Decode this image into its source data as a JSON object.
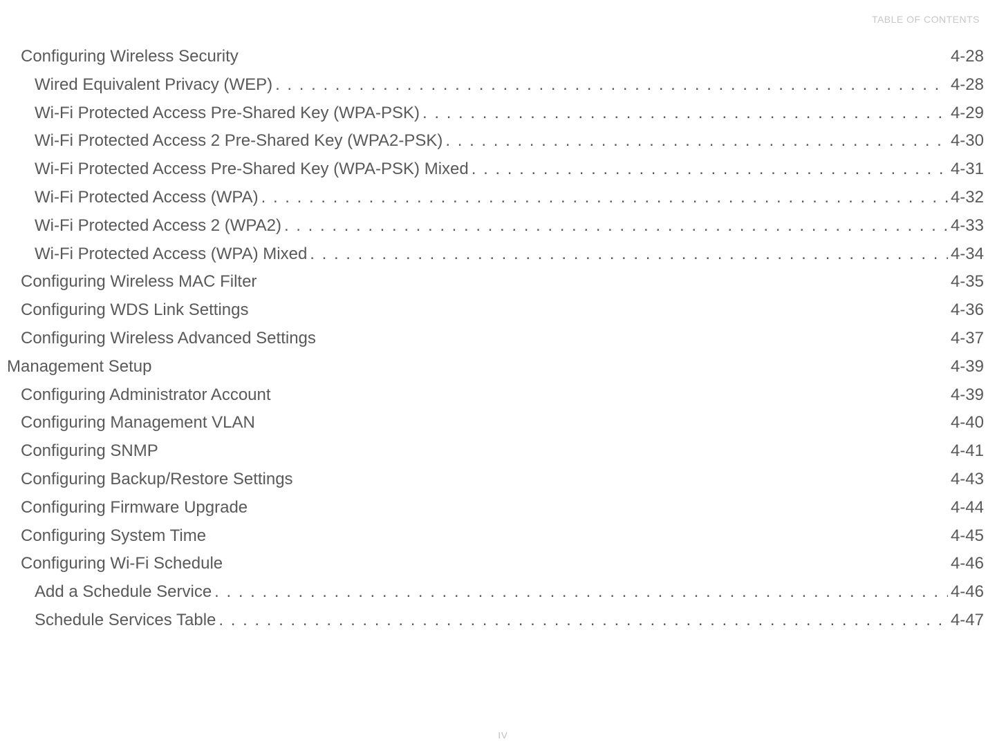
{
  "header": {
    "text": "TABLE OF CONTENTS"
  },
  "toc": {
    "entries": [
      {
        "title": "Configuring Wireless Security",
        "page": "4-28",
        "level": 1,
        "dots": false
      },
      {
        "title": "Wired Equivalent Privacy (WEP)",
        "page": "4-28",
        "level": 2,
        "dots": true
      },
      {
        "title": "Wi-Fi Protected Access Pre-Shared Key (WPA-PSK)",
        "page": "4-29",
        "level": 2,
        "dots": true
      },
      {
        "title": "Wi-Fi Protected Access 2 Pre-Shared Key (WPA2-PSK)",
        "page": "4-30",
        "level": 2,
        "dots": true
      },
      {
        "title": "Wi-Fi Protected Access Pre-Shared Key (WPA-PSK) Mixed",
        "page": "4-31",
        "level": 2,
        "dots": true
      },
      {
        "title": "Wi-Fi Protected Access (WPA)",
        "page": "4-32",
        "level": 2,
        "dots": true
      },
      {
        "title": "Wi-Fi Protected Access 2 (WPA2)",
        "page": "4-33",
        "level": 2,
        "dots": true
      },
      {
        "title": "Wi-Fi Protected Access (WPA) Mixed",
        "page": "4-34",
        "level": 2,
        "dots": true
      },
      {
        "title": "Configuring Wireless MAC Filter",
        "page": "4-35",
        "level": 1,
        "dots": false
      },
      {
        "title": "Configuring WDS Link Settings",
        "page": "4-36",
        "level": 1,
        "dots": false
      },
      {
        "title": "Configuring Wireless Advanced Settings",
        "page": "4-37",
        "level": 1,
        "dots": false
      },
      {
        "title": "Management Setup",
        "page": "4-39",
        "level": 0,
        "dots": false
      },
      {
        "title": "Configuring Administrator Account",
        "page": "4-39",
        "level": 1,
        "dots": false
      },
      {
        "title": "Configuring Management VLAN",
        "page": "4-40",
        "level": 1,
        "dots": false
      },
      {
        "title": "Configuring SNMP",
        "page": "4-41",
        "level": 1,
        "dots": false
      },
      {
        "title": "Configuring Backup/Restore Settings",
        "page": "4-43",
        "level": 1,
        "dots": false
      },
      {
        "title": "Configuring Firmware Upgrade",
        "page": "4-44",
        "level": 1,
        "dots": false
      },
      {
        "title": "Configuring System Time",
        "page": "4-45",
        "level": 1,
        "dots": false
      },
      {
        "title": "Configuring Wi-Fi Schedule",
        "page": "4-46",
        "level": 1,
        "dots": false
      },
      {
        "title": "Add a Schedule Service",
        "page": "4-46",
        "level": 2,
        "dots": true
      },
      {
        "title": "Schedule Services Table",
        "page": "4-47",
        "level": 2,
        "dots": true
      }
    ]
  },
  "footer": {
    "page_label": "IV"
  }
}
